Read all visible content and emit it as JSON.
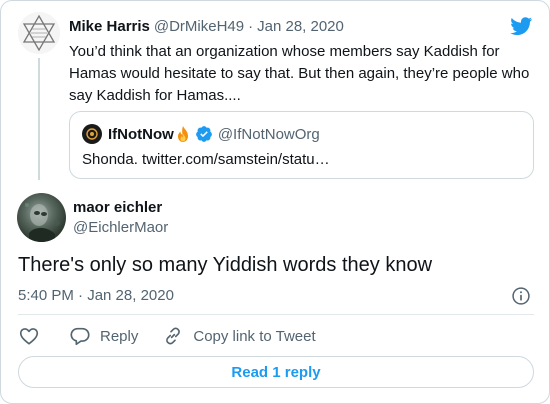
{
  "colors": {
    "brand_blue": "#1d9bf0",
    "text_primary": "#0f1419",
    "text_secondary": "#536471",
    "border": "#cfd9de"
  },
  "icons": {
    "brand": "twitter-bird-icon",
    "info": "info-icon",
    "like": "heart-icon",
    "reply": "reply-icon",
    "copy": "link-icon",
    "verified": "verified-badge-icon",
    "fire": "fire-emoji-icon"
  },
  "parent_tweet": {
    "name": "Mike Harris",
    "handle": "@DrMikeH49",
    "separator": "·",
    "date": "Jan 28, 2020",
    "text": "You’d think that an organization whose members say Kaddish for Hamas would hesitate to say that. But then again, they’re people who say Kaddish for Hamas....",
    "quoted": {
      "name": "IfNotNow",
      "handle": "@IfNotNowOrg",
      "text": "Shonda. twitter.com/samstein/statu…"
    }
  },
  "tweet": {
    "name": "maor eichler",
    "handle": "@EichlerMaor",
    "text": "There's only so many Yiddish words they know",
    "timestamp": "5:40 PM · Jan 28, 2020"
  },
  "actions": {
    "reply_label": "Reply",
    "copy_label": "Copy link to Tweet"
  },
  "read_replies_label": "Read 1 reply"
}
